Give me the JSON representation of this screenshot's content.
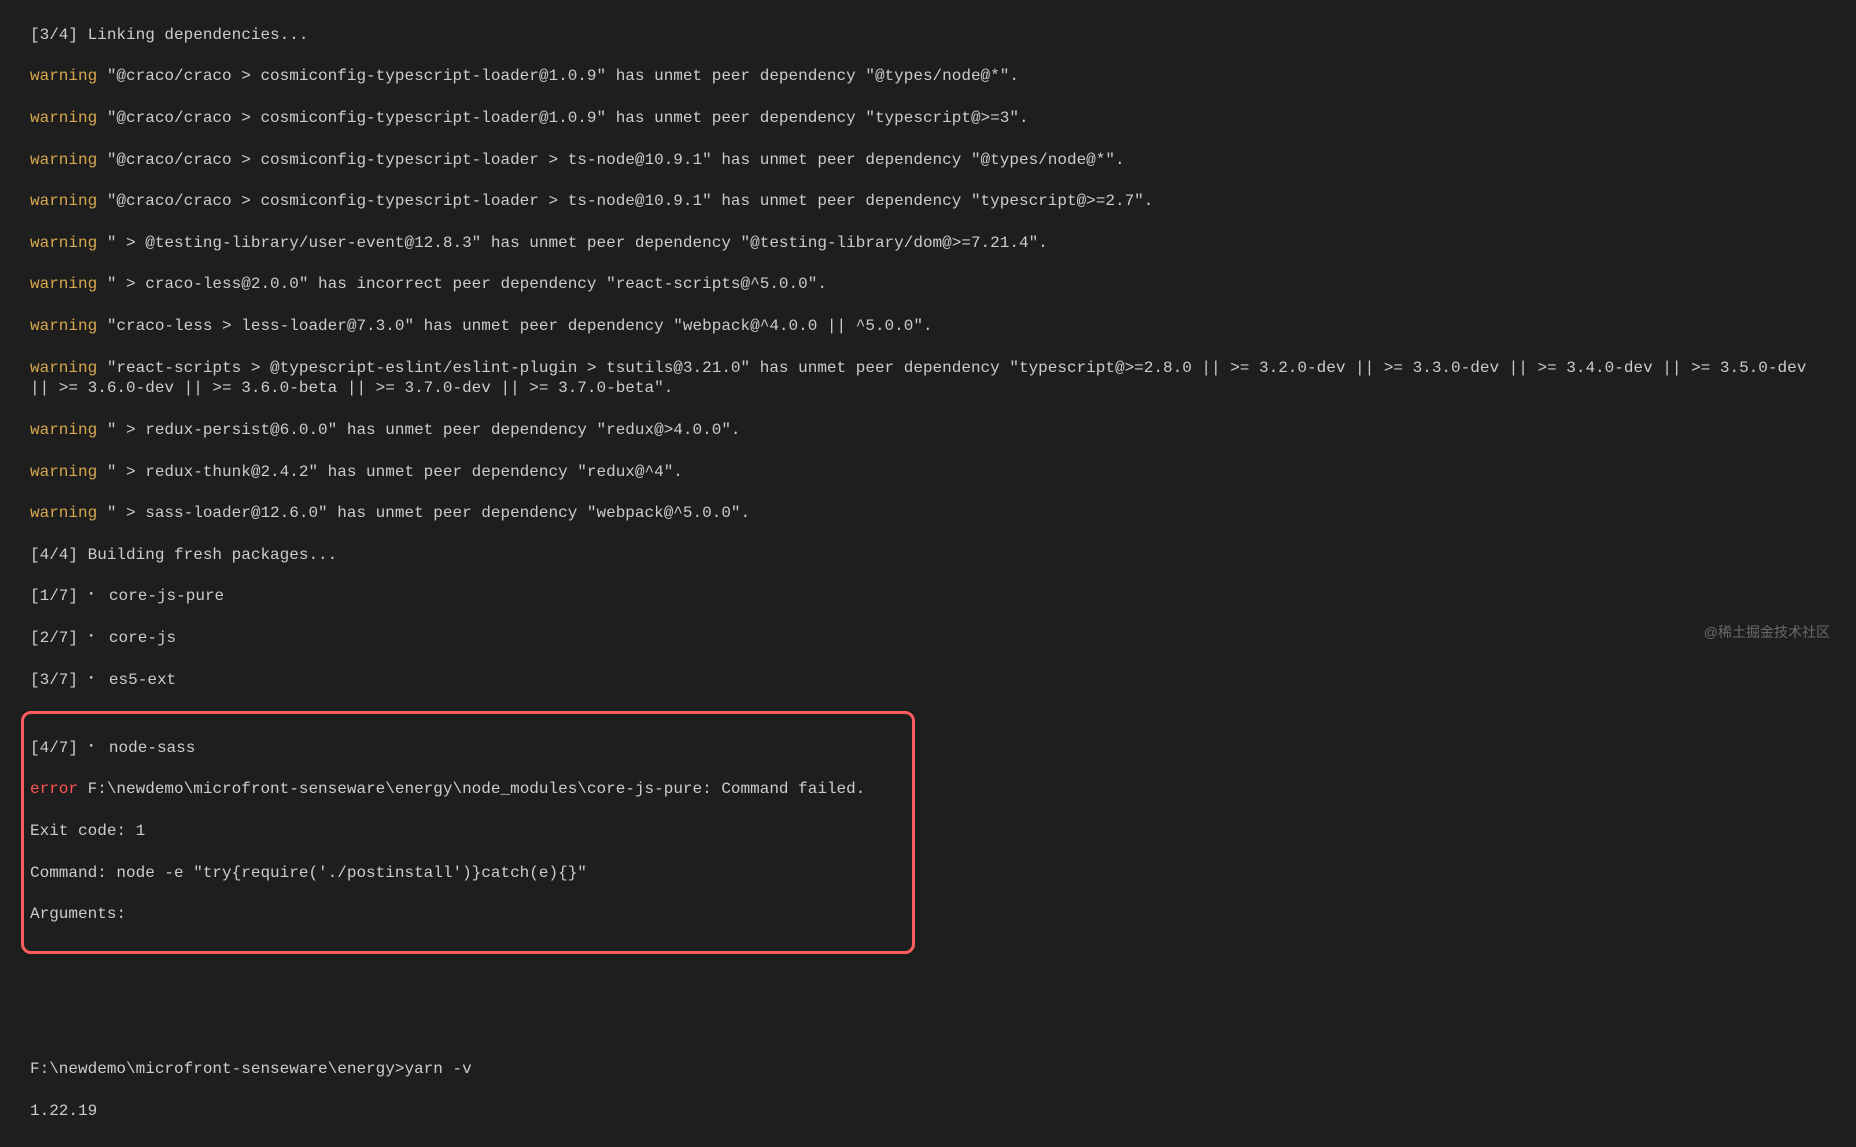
{
  "install": {
    "stepLinking": "[3/4] Linking dependencies...",
    "warnings": [
      "\"@craco/craco > cosmiconfig-typescript-loader@1.0.9\" has unmet peer dependency \"@types/node@*\".",
      "\"@craco/craco > cosmiconfig-typescript-loader@1.0.9\" has unmet peer dependency \"typescript@>=3\".",
      "\"@craco/craco > cosmiconfig-typescript-loader > ts-node@10.9.1\" has unmet peer dependency \"@types/node@*\".",
      "\"@craco/craco > cosmiconfig-typescript-loader > ts-node@10.9.1\" has unmet peer dependency \"typescript@>=2.7\".",
      "\" > @testing-library/user-event@12.8.3\" has unmet peer dependency \"@testing-library/dom@>=7.21.4\".",
      "\" > craco-less@2.0.0\" has incorrect peer dependency \"react-scripts@^5.0.0\".",
      "\"craco-less > less-loader@7.3.0\" has unmet peer dependency \"webpack@^4.0.0 || ^5.0.0\".",
      "\"react-scripts > @typescript-eslint/eslint-plugin > tsutils@3.21.0\" has unmet peer dependency \"typescript@>=2.8.0 || >= 3.2.0-dev || >= 3.3.0-dev || >= 3.4.0-dev || >= 3.5.0-dev || >= 3.6.0-dev || >= 3.6.0-beta || >= 3.7.0-dev || >= 3.7.0-beta\".",
      "\" > redux-persist@6.0.0\" has unmet peer dependency \"redux@>4.0.0\".",
      "\" > redux-thunk@2.4.2\" has unmet peer dependency \"redux@^4\".",
      "\" > sass-loader@12.6.0\" has unmet peer dependency \"webpack@^5.0.0\"."
    ],
    "warningLabel": "warning ",
    "stepBuilding": "[4/4] Building fresh packages...",
    "builds": [
      "[1/7] ⠂ core-js-pure",
      "[2/7] ⠂ core-js",
      "[3/7] ⠂ es5-ext"
    ]
  },
  "highlight": {
    "buildLine": "[4/7] ⠂ node-sass",
    "errorLabel": "error",
    "errorMsg": " F:\\newdemo\\microfront-senseware\\energy\\node_modules\\core-js-pure: Command failed.",
    "exit": "Exit code: 1",
    "command": "Command: node -e \"try{require('./postinstall')}catch(e){}\"",
    "arguments": "Arguments:"
  },
  "prompt": {
    "line": "F:\\newdemo\\microfront-senseware\\energy>yarn -v",
    "version": "1.22.19"
  },
  "watermark": "@稀土掘金技术社区"
}
